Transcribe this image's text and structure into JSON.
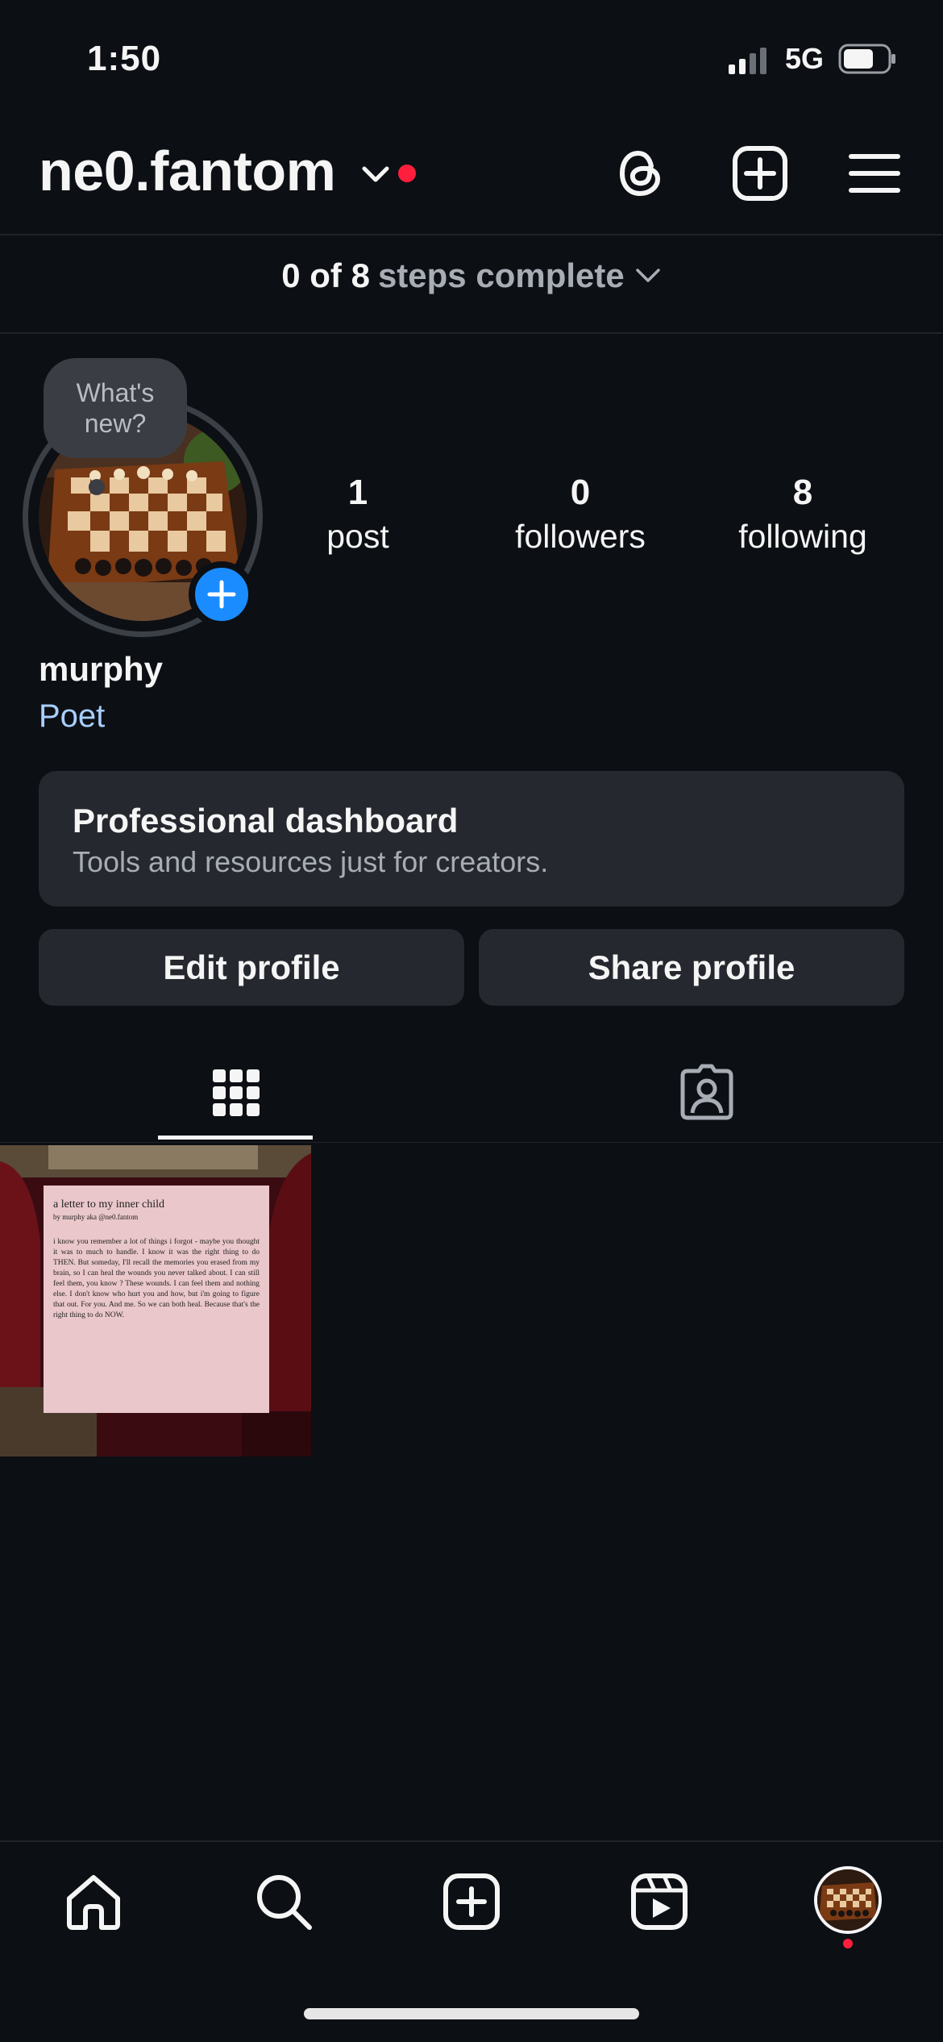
{
  "status_bar": {
    "time": "1:50",
    "network": "5G"
  },
  "header": {
    "username": "ne0.fantom"
  },
  "steps": {
    "count": "0 of 8",
    "label": "steps complete"
  },
  "story_bubble": {
    "text": "What's new?"
  },
  "stats": [
    {
      "value": "1",
      "label": "post"
    },
    {
      "value": "0",
      "label": "followers"
    },
    {
      "value": "8",
      "label": "following"
    }
  ],
  "profile": {
    "name": "murphy",
    "category": "Poet"
  },
  "dashboard": {
    "title": "Professional dashboard",
    "subtitle": "Tools and resources just for creators."
  },
  "buttons": {
    "edit": "Edit profile",
    "share": "Share profile"
  },
  "post": {
    "title": "a letter to my inner child",
    "byline": "by murphy aka @ne0.fantom",
    "body": "i know you remember a lot of things i forgot - maybe you thought it was to much to handle. I know it was the right thing to do THEN. But someday, I'll recall the memories you erased from my brain, so I can heal the wounds you never talked about. I can still feel them, you know ? These wounds. I can feel them and nothing else. I don't know who hurt you and how, but i'm going to figure that out. For you. And me. So we can both heal. Because that's the right thing to do NOW."
  },
  "colors": {
    "background": "#0c0f14",
    "accent_blue": "#1a8cff",
    "notification_red": "#ff1f3d",
    "category_link": "#a8cfff"
  },
  "icons": {
    "header": [
      "threads-icon",
      "new-post-icon",
      "menu-icon"
    ],
    "tabs": [
      "grid-icon",
      "tagged-icon"
    ],
    "nav": [
      "home-icon",
      "search-icon",
      "create-icon",
      "reels-icon",
      "profile-avatar"
    ]
  }
}
